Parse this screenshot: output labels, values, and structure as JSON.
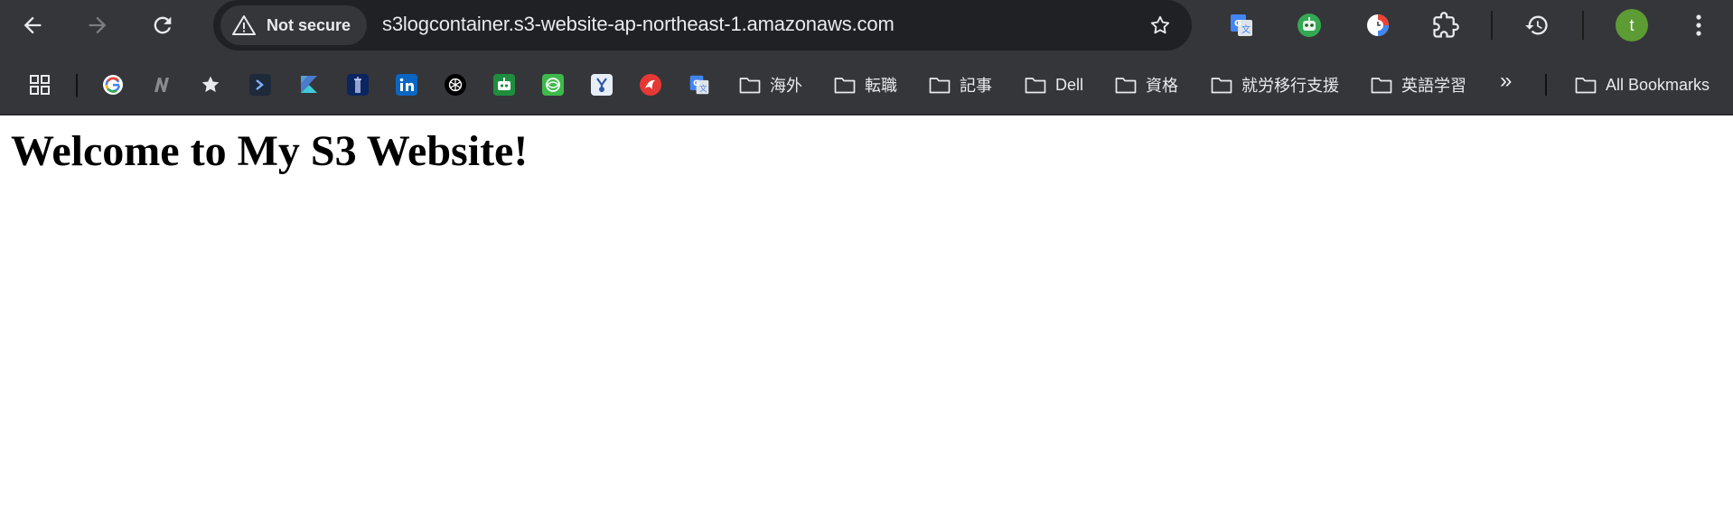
{
  "toolbar": {
    "security_label": "Not secure",
    "url": "s3logcontainer.s3-website-ap-northeast-1.amazonaws.com",
    "avatar_letter": "t"
  },
  "icons": {
    "back": "arrow-left-icon",
    "forward": "arrow-right-icon",
    "reload": "reload-icon",
    "warning": "warning-triangle-icon",
    "bookmark": "star-icon",
    "translate": "google-translate-icon",
    "robot": "robot-extension-icon",
    "clock": "clock-extension-icon",
    "extensions": "puzzle-icon",
    "history": "history-icon",
    "menu": "kebab-menu-icon"
  },
  "bookmarks": {
    "folders": [
      {
        "label": "海外"
      },
      {
        "label": "転職"
      },
      {
        "label": "記事"
      },
      {
        "label": "Dell"
      },
      {
        "label": "資格"
      },
      {
        "label": "就労移行支援"
      },
      {
        "label": "英語学習"
      }
    ],
    "overflow_label": "»",
    "all_bookmarks_label": "All Bookmarks"
  },
  "page": {
    "heading": "Welcome to My S3 Website!"
  },
  "colors": {
    "toolbar_bg": "#35363a",
    "omnibox_bg": "#202124",
    "text": "#e8eaed",
    "avatar": "#5d9b34"
  }
}
